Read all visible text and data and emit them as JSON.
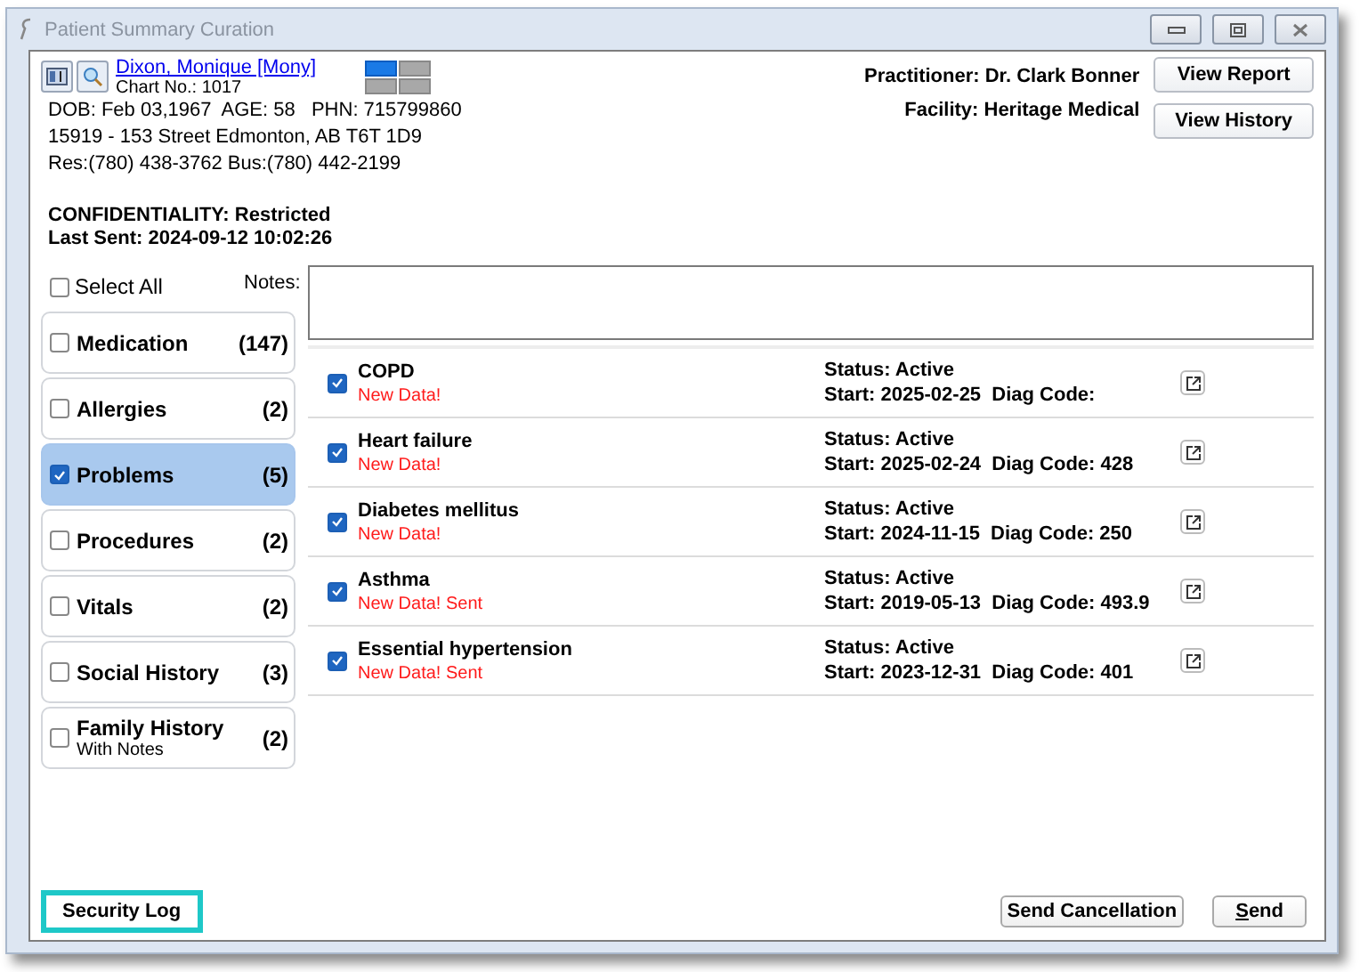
{
  "window": {
    "title": "Patient Summary Curation"
  },
  "patient": {
    "name": "Dixon, Monique [Mony]",
    "chart": "Chart No.: 1017",
    "dob_line": "DOB: Feb 03,1967  AGE: 58   PHN: 715799860",
    "address": "15919 - 153 Street Edmonton, AB  T6T 1D9",
    "phones": "Res:(780) 438-3762 Bus:(780) 442-2199",
    "confidentiality": "CONFIDENTIALITY: Restricted",
    "last_sent": "Last Sent: 2024-09-12 10:02:26"
  },
  "layout_tiles": [
    {
      "selected": true
    },
    {
      "selected": false
    },
    {
      "selected": false
    },
    {
      "selected": false
    }
  ],
  "practitioner": "Practitioner: Dr. Clark Bonner",
  "facility": "Facility: Heritage Medical",
  "header_buttons": [
    "View Report",
    "View History"
  ],
  "select_all": {
    "label": "Select All",
    "checked": false
  },
  "notes": {
    "label": "Notes:"
  },
  "categories": [
    {
      "label": "Medication",
      "count": "(147)",
      "checked": false,
      "selected": false
    },
    {
      "label": "Allergies",
      "count": "(2)",
      "checked": false,
      "selected": false
    },
    {
      "label": "Problems",
      "count": "(5)",
      "checked": true,
      "selected": true
    },
    {
      "label": "Procedures",
      "count": "(2)",
      "checked": false,
      "selected": false
    },
    {
      "label": "Vitals",
      "count": "(2)",
      "checked": false,
      "selected": false
    },
    {
      "label": "Social History",
      "count": "(3)",
      "checked": false,
      "selected": false
    },
    {
      "label": "Family History",
      "count": "(2)",
      "checked": false,
      "selected": false,
      "sublabel": "With Notes"
    }
  ],
  "problems": [
    {
      "name": "COPD",
      "flag": "New Data!",
      "checked": true,
      "status": "Status: Active",
      "detail": "Start: 2025-02-25  Diag Code:"
    },
    {
      "name": "Heart failure",
      "flag": "New Data!",
      "checked": true,
      "status": "Status: Active",
      "detail": "Start: 2025-02-24  Diag Code: 428"
    },
    {
      "name": "Diabetes mellitus",
      "flag": "New Data!",
      "checked": true,
      "status": "Status: Active",
      "detail": "Start: 2024-11-15  Diag Code: 250"
    },
    {
      "name": "Asthma",
      "flag": "New Data! Sent",
      "checked": true,
      "status": "Status: Active",
      "detail": "Start: 2019-05-13  Diag Code: 493.9"
    },
    {
      "name": "Essential hypertension",
      "flag": "New Data! Sent",
      "checked": true,
      "status": "Status: Active",
      "detail": "Start: 2023-12-31  Diag Code: 401"
    }
  ],
  "footer": {
    "security_log": {
      "label": "Security Log",
      "highlighted": true
    },
    "send_cancellation": "Send Cancellation",
    "send": "Send"
  }
}
